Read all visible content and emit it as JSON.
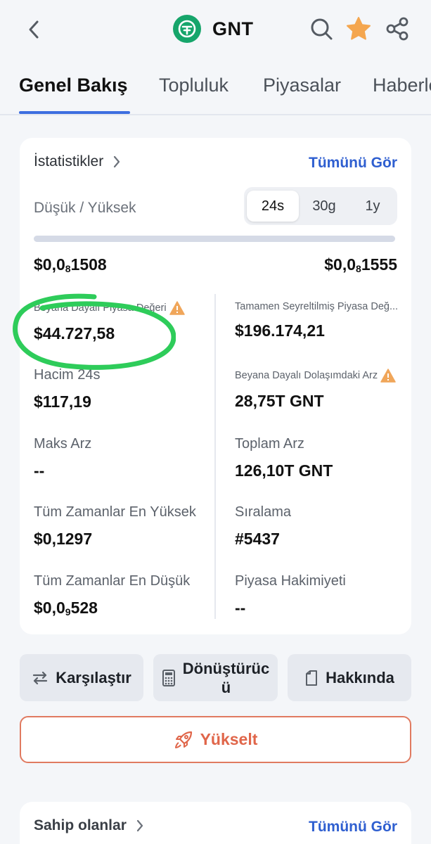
{
  "header": {
    "coin_symbol": "GNT",
    "icons": [
      "back-icon",
      "search-icon",
      "star-icon",
      "share-icon"
    ],
    "favorite_color": "#f4a64f",
    "logo_color": "#16a56b"
  },
  "tabs": [
    {
      "label": "Genel Bakış",
      "active": true
    },
    {
      "label": "Topluluk",
      "active": false
    },
    {
      "label": "Piyasalar",
      "active": false
    },
    {
      "label": "Haberler",
      "active": false
    }
  ],
  "stats": {
    "title": "İstatistikler",
    "see_all": "Tümünü Gör",
    "range_label": "Düşük / Yüksek",
    "periods": [
      {
        "label": "24s",
        "active": true
      },
      {
        "label": "30g",
        "active": false
      },
      {
        "label": "1y",
        "active": false
      }
    ],
    "low": {
      "prefix": "$0,0",
      "sub": "8",
      "digits": "1508"
    },
    "high": {
      "prefix": "$0,0",
      "sub": "8",
      "digits": "1555"
    },
    "left": [
      {
        "label": "Beyana Dayalı Piyasa Değeri",
        "value": "$44.727,58",
        "warning": true
      },
      {
        "label": "Hacim 24s",
        "value": "$117,19",
        "warning": false
      },
      {
        "label": "Maks Arz",
        "value": "--",
        "warning": false
      },
      {
        "label": "Tüm Zamanlar En Yüksek",
        "value": "$0,1297",
        "warning": false
      },
      {
        "label": "Tüm Zamanlar En Düşük",
        "value_prefix": "$0,0",
        "value_sub": "9",
        "value_digits": "528",
        "warning": false
      }
    ],
    "right": [
      {
        "label": "Tamamen Seyreltilmiş Piyasa Değ...",
        "value": "$196.174,21",
        "warning": false
      },
      {
        "label": "Beyana Dayalı Dolaşımdaki Arz",
        "value": "28,75T GNT",
        "warning": true
      },
      {
        "label": "Toplam Arz",
        "value": "126,10T GNT",
        "warning": false
      },
      {
        "label": "Sıralama",
        "value": "#5437",
        "warning": false
      },
      {
        "label": "Piyasa Hakimiyeti",
        "value": "--",
        "warning": false
      }
    ],
    "highlight_color": "#2ecc5a"
  },
  "actions": {
    "compare": "Karşılaştır",
    "converter_line1": "Dönüştürüc",
    "converter_line2": "ü",
    "about": "Hakkında",
    "upgrade": "Yükselt",
    "upgrade_color": "#e0664a"
  },
  "holders": {
    "title": "Sahip olanlar",
    "see_all": "Tümünü Gör"
  }
}
